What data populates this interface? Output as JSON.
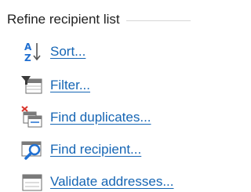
{
  "section": {
    "title": "Refine recipient list"
  },
  "items": [
    {
      "label": "Sort...",
      "icon": "sort-az-icon"
    },
    {
      "label": "Filter...",
      "icon": "filter-icon"
    },
    {
      "label": "Find duplicates...",
      "icon": "find-duplicates-icon"
    },
    {
      "label": "Find recipient...",
      "icon": "find-recipient-icon"
    },
    {
      "label": "Validate addresses...",
      "icon": "validate-addresses-icon"
    }
  ],
  "colors": {
    "link": "#1565b4",
    "heading": "#1e1e1e",
    "divider": "#d6d6d6",
    "accent_blue": "#1f6fd1",
    "accent_red": "#d9342b"
  }
}
